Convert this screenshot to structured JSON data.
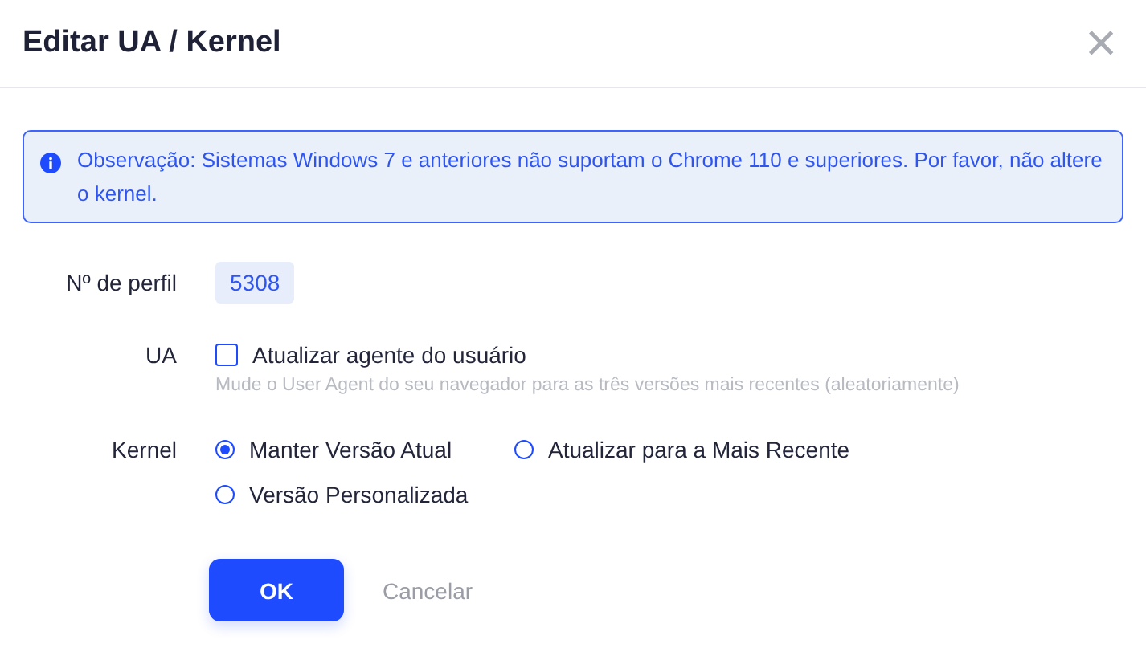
{
  "dialog": {
    "title": "Editar UA / Kernel",
    "close": "×"
  },
  "notice": {
    "text": "Observação: Sistemas Windows 7 e anteriores não suportam o Chrome 110 e superiores. Por favor, não altere o kernel."
  },
  "profile": {
    "label": "Nº de perfil",
    "value": "5308"
  },
  "ua": {
    "label": "UA",
    "option": "Atualizar agente do usuário",
    "checked": false,
    "hint": "Mude o User Agent do seu navegador para as três versões mais recentes (aleatoriamente)"
  },
  "kernel": {
    "label": "Kernel",
    "options": [
      {
        "label": "Manter Versão Atual",
        "selected": true
      },
      {
        "label": "Atualizar para a Mais Recente",
        "selected": false
      },
      {
        "label": "Versão Personalizada",
        "selected": false
      }
    ]
  },
  "buttons": [
    {
      "label": "OK",
      "kind": "primary"
    },
    {
      "label": "Cancelar",
      "kind": "text"
    }
  ]
}
